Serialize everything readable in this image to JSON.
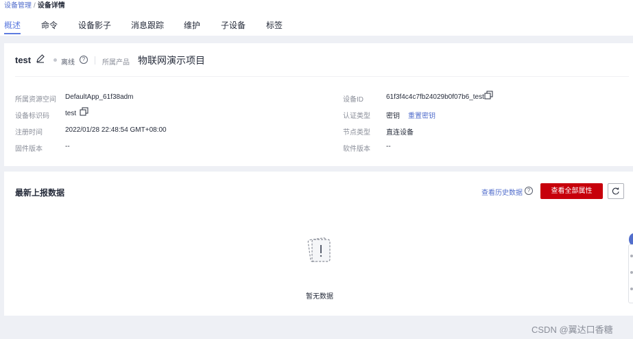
{
  "breadcrumb": {
    "parent": "设备管理",
    "separator": "/",
    "current": "设备详情"
  },
  "tabs": [
    {
      "label": "概述",
      "active": true
    },
    {
      "label": "命令"
    },
    {
      "label": "设备影子"
    },
    {
      "label": "消息跟踪"
    },
    {
      "label": "维护"
    },
    {
      "label": "子设备"
    },
    {
      "label": "标签"
    }
  ],
  "device": {
    "name": "test",
    "status": "离线",
    "product_label": "所属产品",
    "product_value": "物联网演示项目"
  },
  "fields": {
    "resource_space": {
      "label": "所属资源空间",
      "value": "DefaultApp_61f38adm"
    },
    "identifier": {
      "label": "设备标识码",
      "value": "test"
    },
    "register_time": {
      "label": "注册时间",
      "value": "2022/01/28 22:48:54 GMT+08:00"
    },
    "firmware": {
      "label": "固件版本",
      "value": "--"
    },
    "device_id": {
      "label": "设备ID",
      "value": "61f3f4c4c7fb24029b0f07b6_test"
    },
    "auth_type": {
      "label": "认证类型",
      "value": "密钥",
      "action": "重置密钥"
    },
    "node_type": {
      "label": "节点类型",
      "value": "直连设备"
    },
    "software": {
      "label": "软件版本",
      "value": "--"
    }
  },
  "latest": {
    "title": "最新上报数据",
    "history_link": "查看历史数据",
    "view_all_button": "查看全部属性",
    "empty_text": "暂无数据"
  },
  "watermark": "CSDN @翼达口香糖",
  "colors": {
    "primary": "#c7000b",
    "link": "#526ecc",
    "tab_active": "#5e7ce0"
  }
}
